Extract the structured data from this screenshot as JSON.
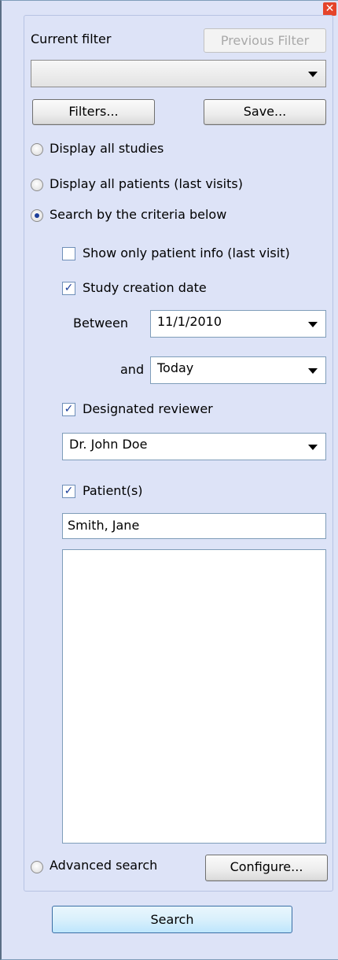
{
  "current_filter": {
    "label": "Current filter",
    "previous_button": "Previous Filter",
    "selected": ""
  },
  "buttons": {
    "filters": "Filters...",
    "save": "Save...",
    "configure": "Configure...",
    "search": "Search"
  },
  "options": {
    "display_all_studies": "Display all studies",
    "display_all_patients": "Display all patients (last visits)",
    "search_by_criteria": "Search by the criteria below",
    "advanced_search": "Advanced search"
  },
  "criteria": {
    "show_only_patient_info": "Show only patient info (last visit)",
    "study_creation_date": "Study creation date",
    "between_label": "Between",
    "between_value": "11/1/2010",
    "and_label": "and",
    "and_value": "Today",
    "designated_reviewer": "Designated reviewer",
    "reviewer_value": "Dr. John Doe",
    "patients": "Patient(s)",
    "patient_input_value": "Smith, Jane"
  },
  "icons": {
    "close": "close-icon",
    "dropdown": "chevron-down-icon",
    "check": "checkmark"
  }
}
